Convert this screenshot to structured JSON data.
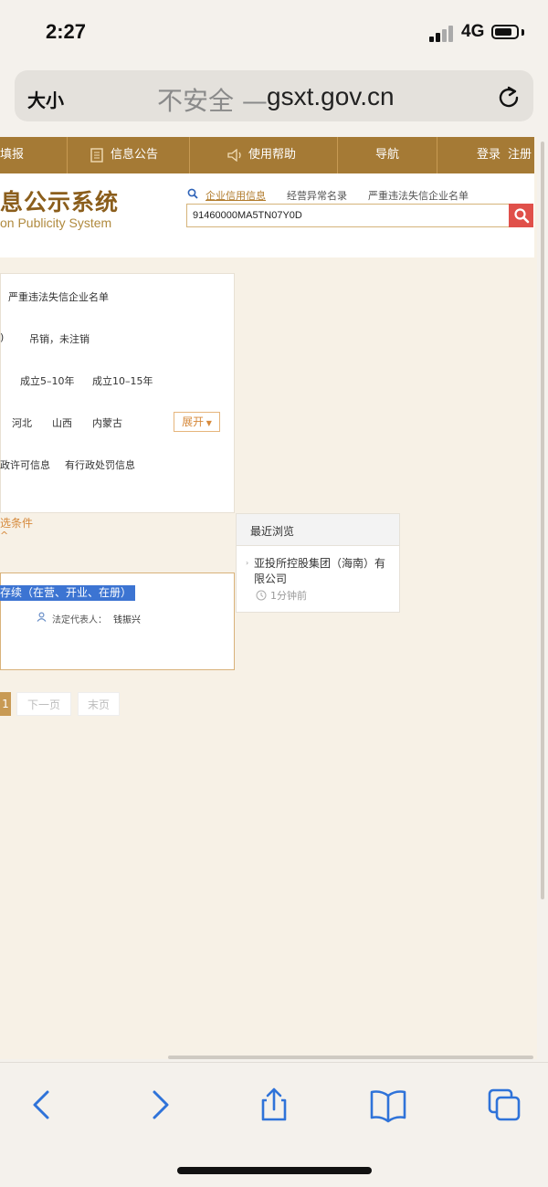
{
  "status_bar": {
    "time": "2:27",
    "network": "4G"
  },
  "address_bar": {
    "text_size": "大小",
    "security": "不安全 —",
    "domain": "gsxt.gov.cn"
  },
  "site": {
    "nav": {
      "fill_report": "填报",
      "announcement": "信息公告",
      "help": "使用帮助",
      "navigation": "导航",
      "login": "登录",
      "register": "注册"
    },
    "logo_cn": "息公示系统",
    "logo_en": "on Publicity System",
    "search_tabs": [
      "企业信用信息",
      "经营异常名录",
      "严重违法失信企业名单"
    ],
    "search_value": "91460000MA5TN07Y0D"
  },
  "filters": {
    "row1": "严重违法失信企业名单",
    "row2_a": ")",
    "row2_b": "吊销，未注销",
    "row3_a": "成立5–10年",
    "row3_b": "成立10–15年",
    "row4_a": "河北",
    "row4_b": "山西",
    "row4_c": "内蒙古",
    "expand": "展开",
    "row5_a": "政许可信息",
    "row5_b": "有行政处罚信息",
    "clear": "选条件",
    "clear_arrow": "^"
  },
  "result": {
    "status": "存续（在营、开业、在册）",
    "rep_label": "法定代表人：",
    "rep_value": "钱振兴"
  },
  "recent": {
    "title": "最近浏览",
    "company": "亚投所控股集团（海南）有限公司",
    "time": "1分钟前"
  },
  "pagination": {
    "current": "1",
    "next": "下一页",
    "last": "末页"
  }
}
